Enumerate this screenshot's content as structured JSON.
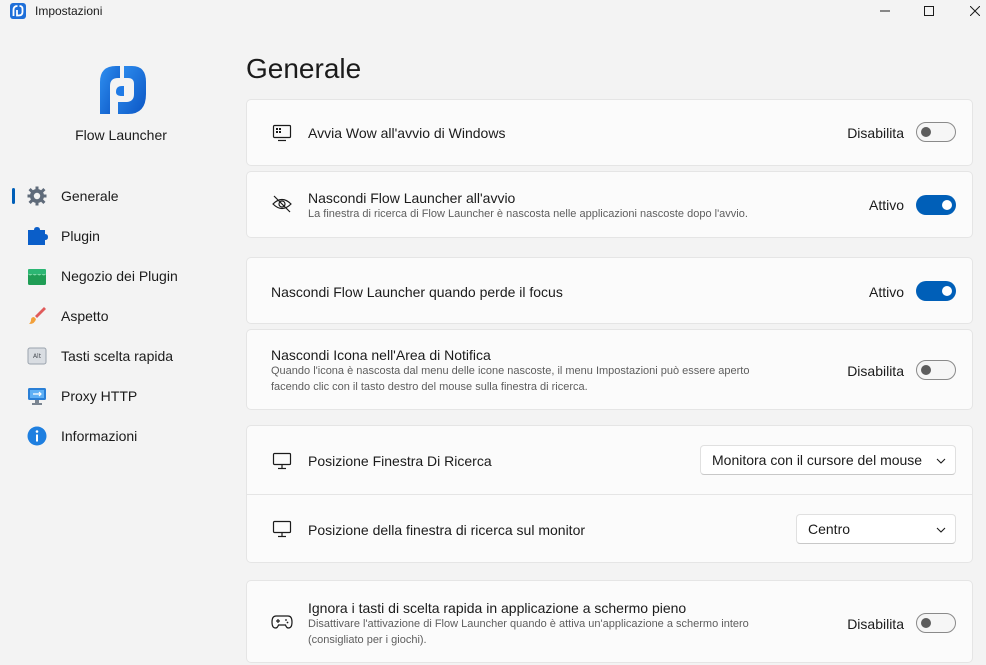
{
  "window": {
    "title": "Impostazioni",
    "icon": "flow-launcher-icon"
  },
  "sidebar": {
    "brand": "Flow Launcher",
    "items": [
      {
        "label": "Generale",
        "icon": "gear-icon",
        "active": true
      },
      {
        "label": "Plugin",
        "icon": "puzzle-icon",
        "active": false
      },
      {
        "label": "Negozio dei Plugin",
        "icon": "store-icon",
        "active": false
      },
      {
        "label": "Aspetto",
        "icon": "paintbrush-icon",
        "active": false
      },
      {
        "label": "Tasti scelta rapida",
        "icon": "keyboard-alt-icon",
        "active": false
      },
      {
        "label": "Proxy HTTP",
        "icon": "network-icon",
        "active": false
      },
      {
        "label": "Informazioni",
        "icon": "info-icon",
        "active": false
      }
    ]
  },
  "main": {
    "title": "Generale",
    "settings": {
      "startup": {
        "title": "Avvia Wow all'avvio di Windows",
        "state": "Disabilita",
        "enabled": false,
        "icon": "startup-icon"
      },
      "hide_on_startup": {
        "title": "Nascondi Flow Launcher all'avvio",
        "description": "La finestra di ricerca di Flow Launcher è nascosta nelle applicazioni nascoste dopo l'avvio.",
        "state": "Attivo",
        "enabled": true,
        "icon": "eye-hidden-icon"
      },
      "hide_lose_focus": {
        "title": "Nascondi Flow Launcher quando perde il focus",
        "state": "Attivo",
        "enabled": true
      },
      "hide_tray_icon": {
        "title": "Nascondi Icona nell'Area di Notifica",
        "description_line1": "Quando l'icona è nascosta dal menu delle icone nascoste, il menu Impostazioni può essere aperto",
        "description_line2": "facendo clic con il tasto destro del mouse sulla finestra di ricerca.",
        "state": "Disabilita",
        "enabled": false
      },
      "search_window_position": {
        "title": "Posizione Finestra Di Ricerca",
        "value": "Monitora con il cursore del mouse",
        "icon": "monitor-icon"
      },
      "search_window_monitor_position": {
        "title": "Posizione della finestra di ricerca sul monitor",
        "value": "Centro",
        "icon": "monitor-icon"
      },
      "ignore_hotkeys_fullscreen": {
        "title": "Ignora i tasti di scelta rapida in applicazione a schermo pieno",
        "description_line1": "Disattivare l'attivazione di Flow Launcher quando è attiva un'applicazione a schermo intero",
        "description_line2": "(consigliato per i giochi).",
        "state": "Disabilita",
        "enabled": false,
        "icon": "gamepad-icon"
      }
    }
  },
  "colors": {
    "accent": "#005fb8",
    "background": "#f3f3f3",
    "card": "#fbfbfb"
  }
}
